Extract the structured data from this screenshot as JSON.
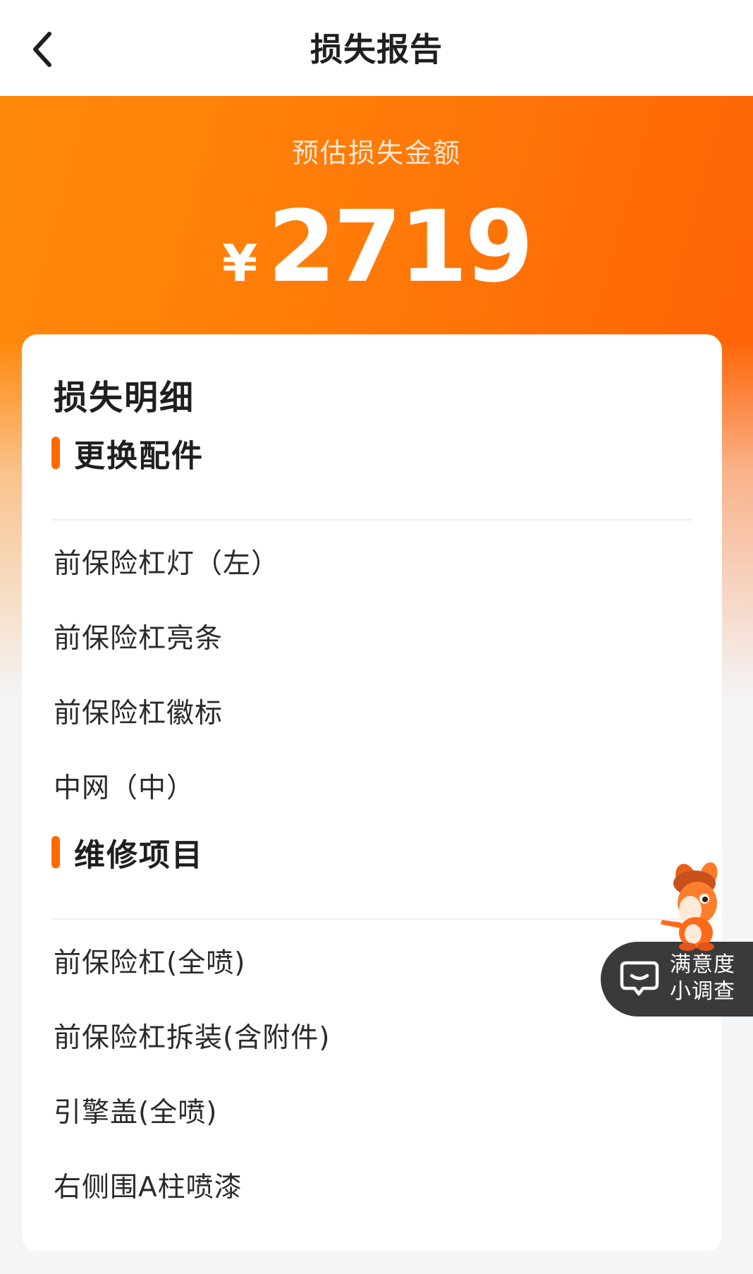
{
  "nav": {
    "title": "损失报告",
    "back_icon": "chevron-left-icon"
  },
  "hero": {
    "label": "预估损失金额",
    "currency": "¥",
    "amount": "2719"
  },
  "details": {
    "title": "损失明细",
    "sections": [
      {
        "title": "更换配件",
        "items": [
          "前保险杠灯（左）",
          "前保险杠亮条",
          "前保险杠徽标",
          "中网（中）"
        ]
      },
      {
        "title": "维修项目",
        "items": [
          "前保险杠(全喷)",
          "前保险杠拆装(含附件)",
          "引擎盖(全喷)",
          "右侧围A柱喷漆"
        ]
      }
    ]
  },
  "survey": {
    "line1": "满意度",
    "line2": "小调查",
    "icon": "chat-icon"
  },
  "colors": {
    "accent": "#ff6a00",
    "hero_start": "#ff8a0a",
    "hero_end": "#ff5e05"
  }
}
